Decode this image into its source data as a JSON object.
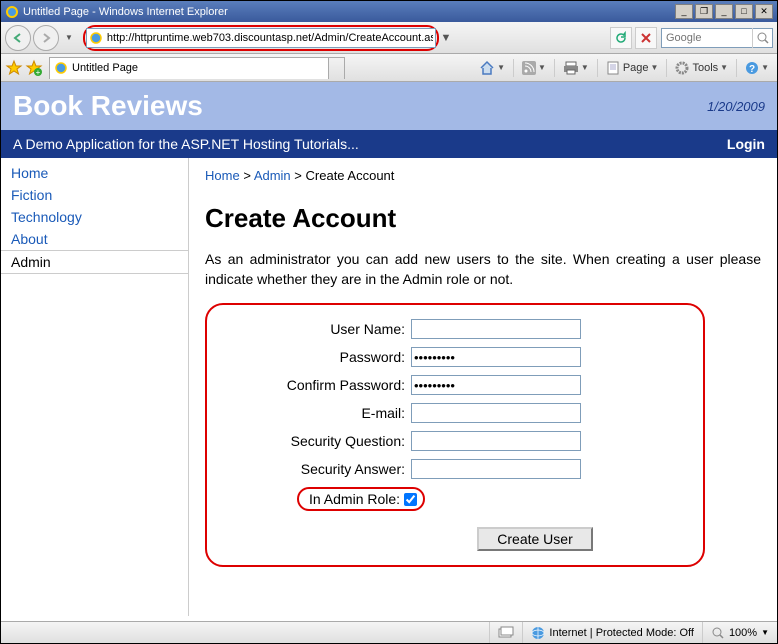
{
  "window": {
    "title": "Untitled Page - Windows Internet Explorer"
  },
  "address": {
    "url": "http://httpruntime.web703.discountasp.net/Admin/CreateAccount.aspx"
  },
  "search": {
    "placeholder": "Google"
  },
  "tab": {
    "title": "Untitled Page"
  },
  "toolbar": {
    "page": "Page",
    "tools": "Tools"
  },
  "site": {
    "title": "Book Reviews",
    "date": "1/20/2009",
    "subtitle": "A Demo Application for the ASP.NET Hosting Tutorials...",
    "login": "Login"
  },
  "sidebar": {
    "items": [
      {
        "label": "Home"
      },
      {
        "label": "Fiction"
      },
      {
        "label": "Technology"
      },
      {
        "label": "About"
      },
      {
        "label": "Admin"
      }
    ]
  },
  "breadcrumb": {
    "home": "Home",
    "admin": "Admin",
    "current": "Create Account",
    "sep": ">"
  },
  "page": {
    "heading": "Create Account",
    "intro": "As an administrator you can add new users to the site. When creating a user please indicate whether they are in the Admin role or not."
  },
  "form": {
    "username_label": "User Name:",
    "username_value": "",
    "password_label": "Password:",
    "password_value": "•••••••••",
    "confirm_label": "Confirm Password:",
    "confirm_value": "•••••••••",
    "email_label": "E-mail:",
    "email_value": "",
    "question_label": "Security Question:",
    "question_value": "",
    "answer_label": "Security Answer:",
    "answer_value": "",
    "admin_label": "In Admin Role:",
    "create_label": "Create User"
  },
  "status": {
    "zone": "Internet | Protected Mode: Off",
    "zoom": "100%"
  }
}
